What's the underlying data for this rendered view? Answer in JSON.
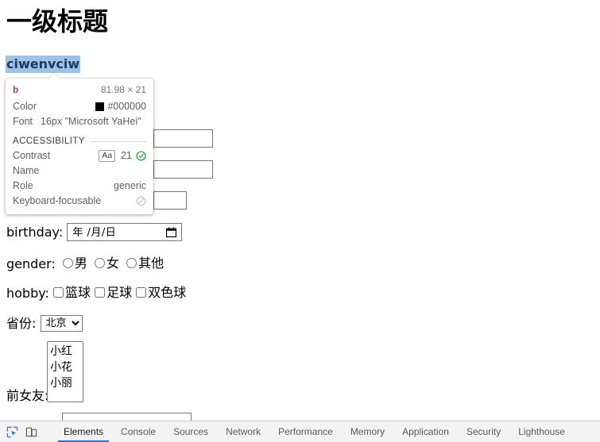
{
  "page": {
    "heading": "一级标题",
    "selected_text": "ciwenvciw",
    "inputs": [
      {
        "name": "text-input-1",
        "value": ""
      },
      {
        "name": "text-input-2",
        "value": ""
      },
      {
        "name": "text-input-3",
        "value": ""
      },
      {
        "name": "text-input-bottom",
        "value": ""
      }
    ],
    "birthday": {
      "label": "birthday:",
      "value": "年 /月/日",
      "icon": "calendar-icon"
    },
    "gender": {
      "label": "gender:",
      "options": [
        "男",
        "女",
        "其他"
      ]
    },
    "hobby": {
      "label": "hobby:",
      "options": [
        "篮球",
        "足球",
        "双色球"
      ]
    },
    "province": {
      "label": "省份:",
      "selected": "北京",
      "options": [
        "北京"
      ]
    },
    "exgirlfriend": {
      "label": "前女友:",
      "options": [
        "小红",
        "小花",
        "小丽"
      ]
    }
  },
  "tooltip": {
    "tag": "b",
    "dimensions": "81.98 × 21",
    "color_label": "Color",
    "color_value": "#000000",
    "color_swatch": "#000000",
    "font_label": "Font",
    "font_value": "16px \"Microsoft YaHei\"",
    "section_label": "ACCESSIBILITY",
    "contrast_label": "Contrast",
    "contrast_sample": "Aa",
    "contrast_value": "21",
    "contrast_status_icon": "check-circle-icon",
    "name_label": "Name",
    "name_value": "",
    "role_label": "Role",
    "role_value": "generic",
    "keyboard_label": "Keyboard-focusable",
    "keyboard_icon": "no-entry-icon"
  },
  "devtools": {
    "inspect_icon": "inspect-cursor-icon",
    "device_icon": "device-toolbar-icon",
    "accent": "#1a73e8",
    "tabs": [
      {
        "label": "Elements",
        "active": true
      },
      {
        "label": "Console",
        "active": false
      },
      {
        "label": "Sources",
        "active": false
      },
      {
        "label": "Network",
        "active": false
      },
      {
        "label": "Performance",
        "active": false
      },
      {
        "label": "Memory",
        "active": false
      },
      {
        "label": "Application",
        "active": false
      },
      {
        "label": "Security",
        "active": false
      },
      {
        "label": "Lighthouse",
        "active": false
      }
    ]
  }
}
